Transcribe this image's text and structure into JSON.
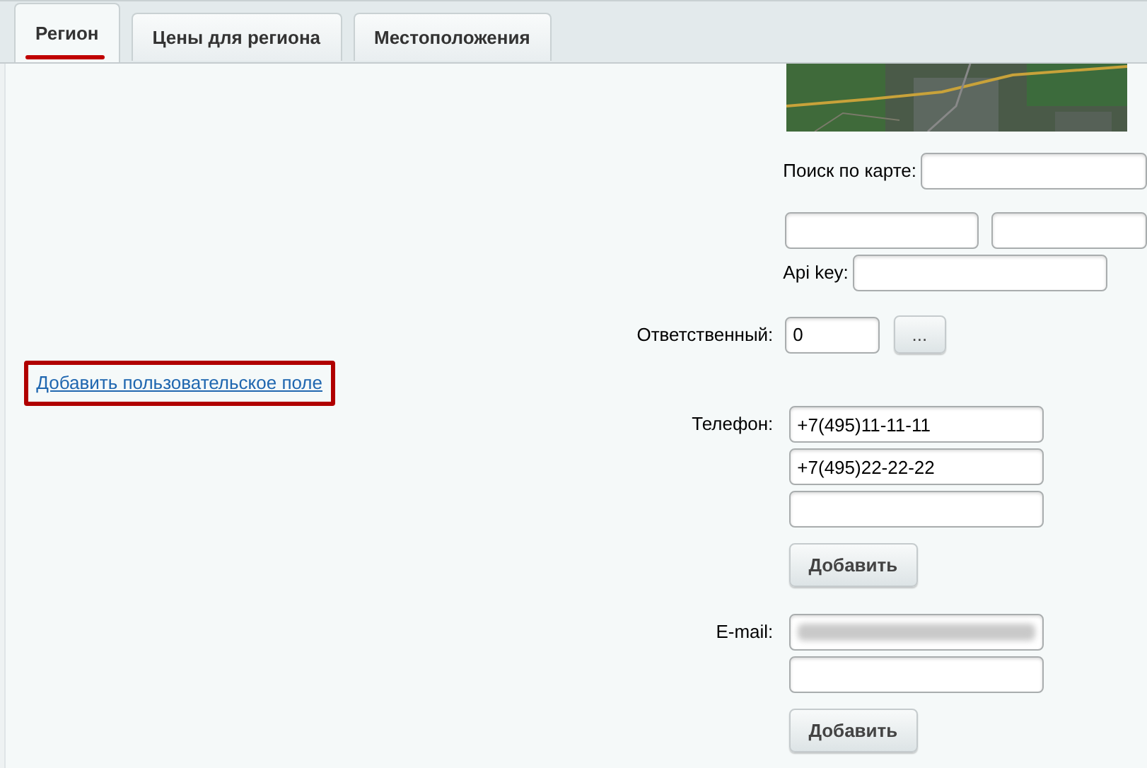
{
  "tabs": [
    {
      "label": "Регион",
      "selected": true
    },
    {
      "label": "Цены для региона",
      "selected": false
    },
    {
      "label": "Местоположения",
      "selected": false
    }
  ],
  "map": {
    "search_label": "Поиск по карте:",
    "api_key_label": "Api key:"
  },
  "responsible": {
    "label": "Ответственный:",
    "value": "0",
    "button": "..."
  },
  "custom_field_link": {
    "label": "Добавить пользовательское поле",
    "highlighted": true
  },
  "phone": {
    "label": "Телефон:",
    "fields": [
      {
        "value": "+7(495)11-11-11",
        "blurred": false
      },
      {
        "value": "+7(495)22-22-22",
        "blurred": false
      },
      {
        "blurred": false
      }
    ],
    "button": "Добавить"
  },
  "email": {
    "label": "E-mail:",
    "fields": [
      {
        "blurred": true
      },
      {
        "blurred": false
      }
    ],
    "button": "Добавить"
  }
}
